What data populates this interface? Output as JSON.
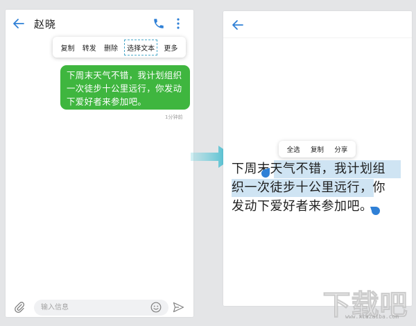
{
  "left_screen": {
    "contact_name": "赵晓",
    "context_menu": [
      "复制",
      "转发",
      "删除",
      "选择文本",
      "更多"
    ],
    "selected_menu_index": 3,
    "message_text": "下周末天气不错，我计划组织一次徒步十公里远行，你发动下爱好者来参加吧。",
    "message_time": "1分钟前",
    "input_placeholder": "输入信息"
  },
  "right_screen": {
    "selection_menu": [
      "全选",
      "复制",
      "分享"
    ],
    "text_lines": [
      "下周末天气不错，我计划组",
      "织一次徒步十公里远行，你",
      "发动下爱好者来参加吧。"
    ]
  },
  "watermark": {
    "logo_text": "下载吧",
    "url": "www.xiazaiba.com"
  },
  "colors": {
    "bubble": "#3fb63f",
    "accent": "#2f80d6",
    "highlight": "#cfe4f3",
    "arrow": "#3dbcd0"
  }
}
